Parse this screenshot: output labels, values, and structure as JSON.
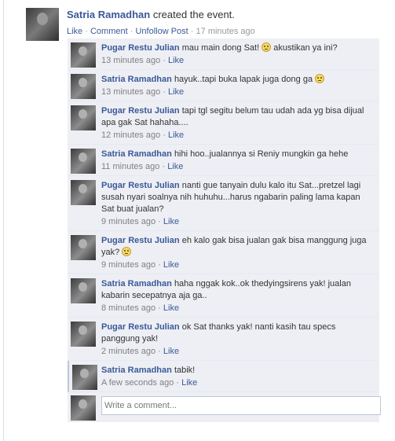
{
  "story": {
    "author": "Satria Ramadhan",
    "action": "created the event.",
    "links": {
      "like": "Like",
      "comment": "Comment",
      "unfollow": "Unfollow Post"
    },
    "separator": "·",
    "time": "17 minutes ago"
  },
  "comments": [
    {
      "author": "Pugar Restu Julian",
      "text_before": "mau main dong Sat!",
      "emoticon": "confused-emoticon",
      "text_after": "akustikan ya ini?",
      "time": "13 minutes ago",
      "like": "Like"
    },
    {
      "author": "Satria Ramadhan",
      "text_before": "hayuk..tapi buka lapak juga dong ga",
      "emoticon": "confused-emoticon",
      "text_after": "",
      "time": "13 minutes ago",
      "like": "Like"
    },
    {
      "author": "Pugar Restu Julian",
      "text_before": "tapi tgl segitu belum tau udah ada yg bisa dijual apa gak Sat hahaha....",
      "emoticon": null,
      "text_after": "",
      "time": "12 minutes ago",
      "like": "Like"
    },
    {
      "author": "Satria Ramadhan",
      "text_before": "hihi hoo..jualannya si Reniy mungkin ga hehe",
      "emoticon": null,
      "text_after": "",
      "time": "11 minutes ago",
      "like": "Like"
    },
    {
      "author": "Pugar Restu Julian",
      "text_before": "nanti gue tanyain dulu kalo itu Sat...pretzel lagi susah nyari soalnya nih huhuhu...harus ngabarin paling lama kapan Sat buat jualan?",
      "emoticon": null,
      "text_after": "",
      "time": "9 minutes ago",
      "like": "Like"
    },
    {
      "author": "Pugar Restu Julian",
      "text_before": "eh kalo gak bisa jualan gak bisa manggung juga yak?",
      "emoticon": "confused-emoticon",
      "text_after": "",
      "time": "9 minutes ago",
      "like": "Like"
    },
    {
      "author": "Satria Ramadhan",
      "text_before": "haha nggak kok..ok thedyingsirens yak! jualan kabarin secepatnya aja ga..",
      "emoticon": null,
      "text_after": "",
      "time": "8 minutes ago",
      "like": "Like"
    },
    {
      "author": "Pugar Restu Julian",
      "text_before": "ok Sat thanks yak! nanti kasih tau specs panggung yak!",
      "emoticon": null,
      "text_after": "",
      "time": "2 minutes ago",
      "like": "Like"
    },
    {
      "author": "Satria Ramadhan",
      "text_before": "tabik!",
      "emoticon": null,
      "text_after": "",
      "time": "A few seconds ago",
      "like": "Like"
    }
  ],
  "composer": {
    "placeholder": "Write a comment..."
  }
}
